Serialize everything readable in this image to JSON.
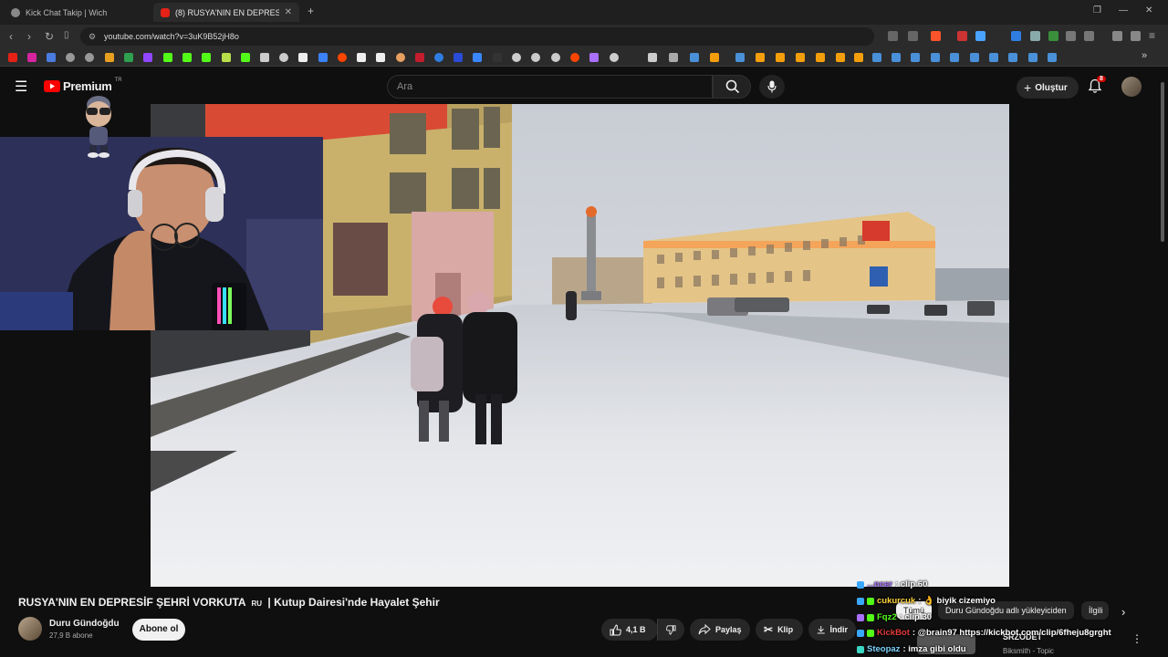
{
  "browser": {
    "tabs": [
      {
        "label": "Kick Chat Takip | Wich",
        "active": false
      },
      {
        "label": "(8) RUSYA'NIN EN DEPRESİF ŞEH...",
        "active": true
      }
    ],
    "new_tab": "+",
    "url": "youtube.com/watch?v=3uK9B52jH8o"
  },
  "youtube": {
    "logo_text": "Premium",
    "logo_sup": "TR",
    "search_placeholder": "Ara",
    "create_label": "Oluştur",
    "notif_count": "8"
  },
  "video": {
    "title": "RUSYA'NIN EN DEPRESİF ŞEHRİ VORKUTA 🇷🇺 | Kutup Dairesi'nde Hayalet Şehir",
    "title_main": "RUSYA'NIN EN DEPRESİF ŞEHRİ VORKUTA",
    "title_flag": "RU",
    "title_rest": "| Kutup Dairesi'nde Hayalet Şehir",
    "channel": "Duru Gündoğdu",
    "subscribers": "27,9 B abone",
    "subscribe_label": "Abone ol",
    "likes": "4,1 B",
    "share_label": "Paylaş",
    "clip_label": "Klip",
    "download_label": "İndir"
  },
  "chat": [
    {
      "user": "...ncer",
      "text": ": clip 60",
      "color": "#a970ff"
    },
    {
      "user": "cukurcuk",
      "text": ": 👌 biyik cizemiyo",
      "color": "#ffd23d"
    },
    {
      "user": "Fqz2",
      "text": ": clip 30",
      "color": "#53fc18"
    },
    {
      "user": "KickBot",
      "text": ": @brain97 https://kickbot.com/clip/6fheju8grght",
      "color": "#e53a3a"
    },
    {
      "user": "Steopaz",
      "text": ": imza gibi oldu",
      "color": "#7dd3fc"
    }
  ],
  "related_chips": [
    "Tümü",
    "Duru Gündoğdu adlı yükleyiciden",
    "İlgili"
  ],
  "up_next": {
    "title": "SRZODET",
    "subtitle": "Biksmith - Topic"
  },
  "colors": {
    "accent": "#ff0000",
    "background": "#0f0f0f"
  }
}
